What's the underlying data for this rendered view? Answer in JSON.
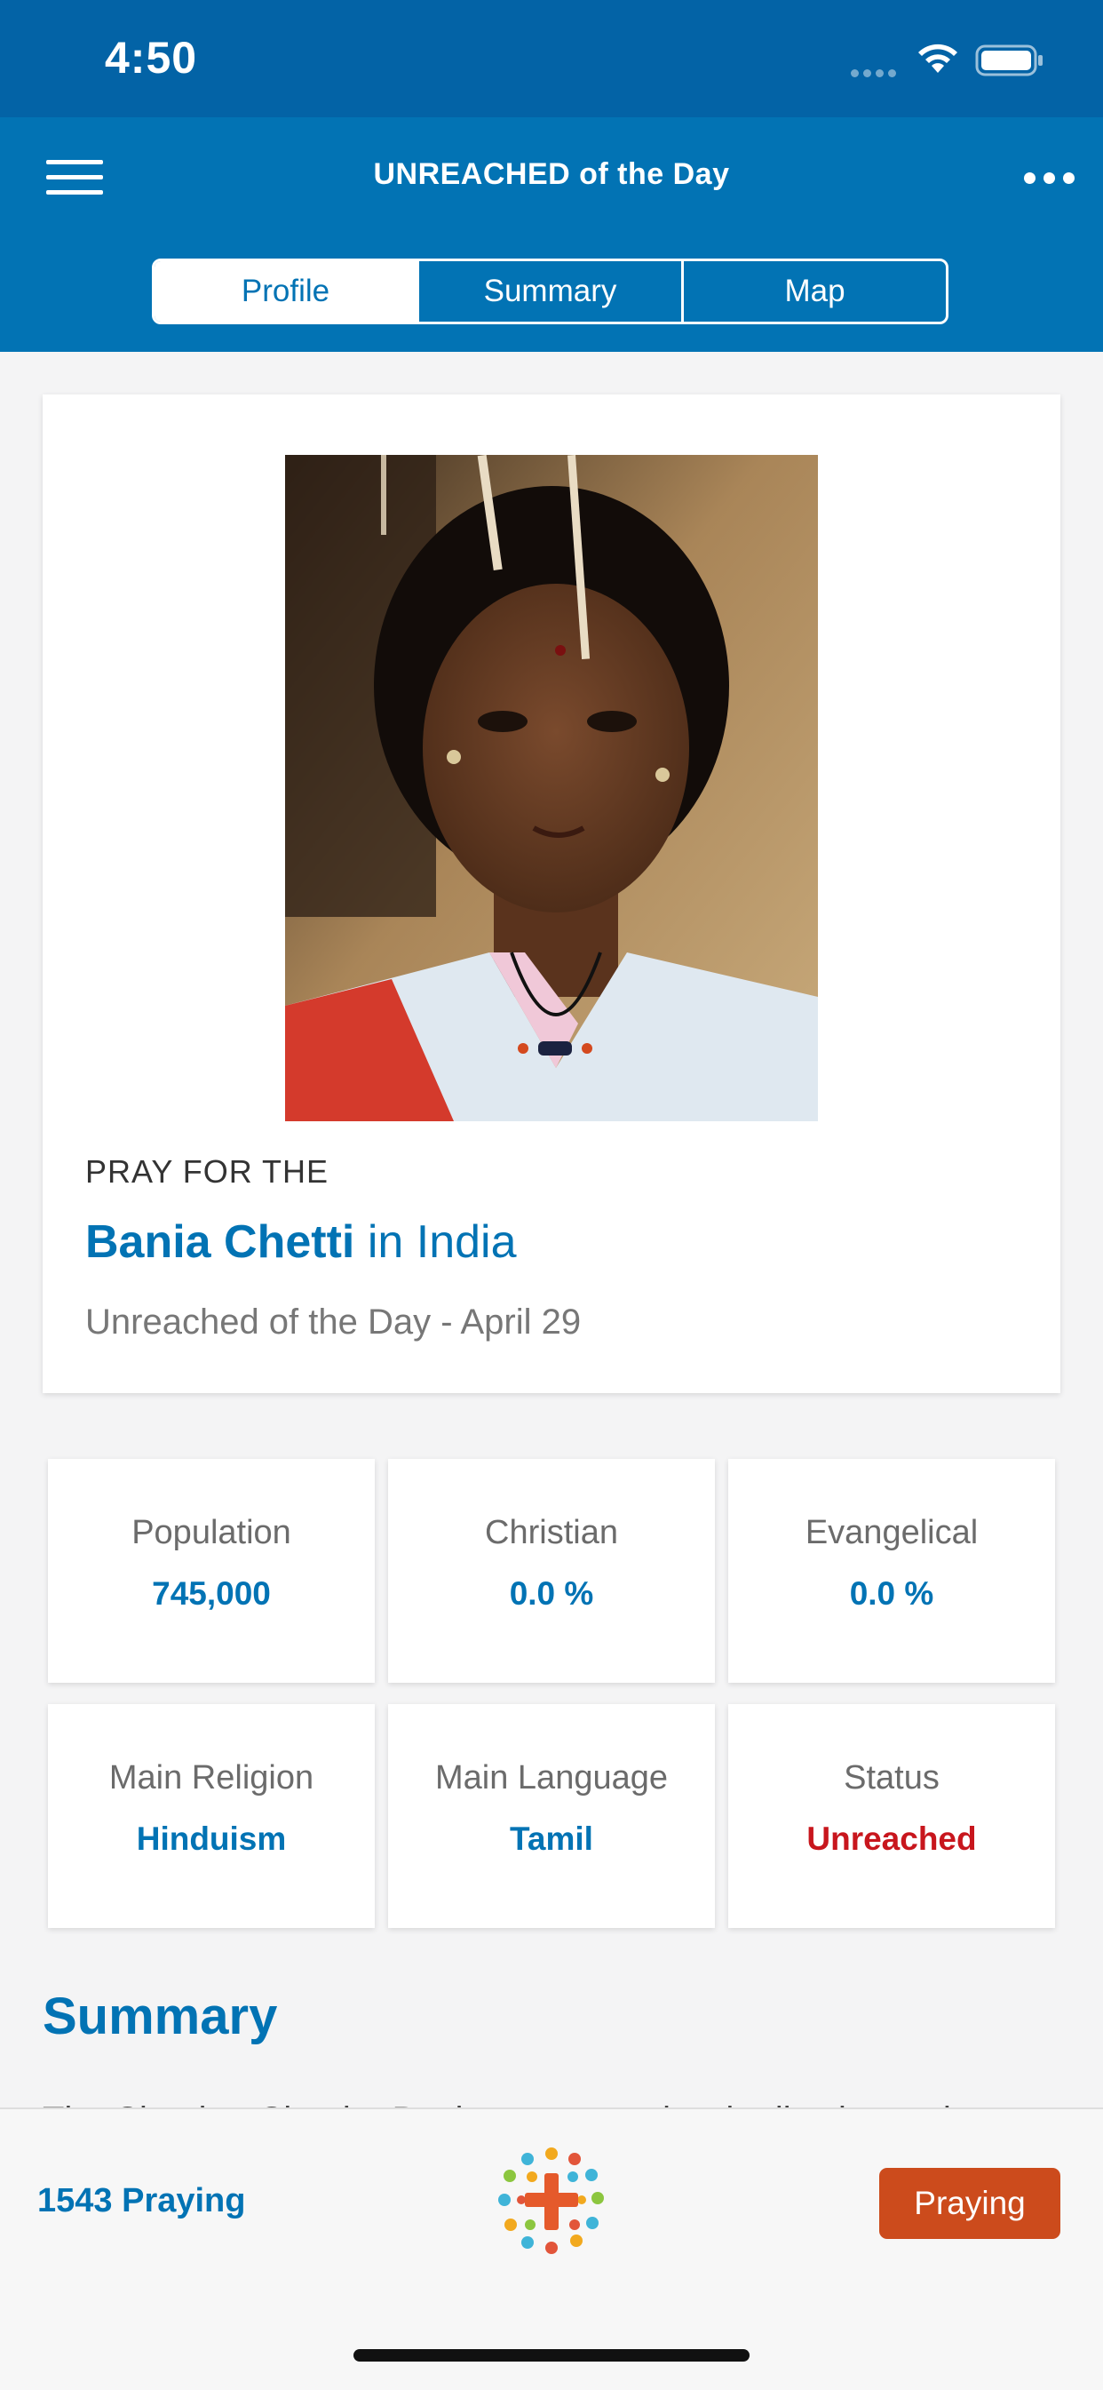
{
  "status_bar": {
    "time": "4:50"
  },
  "header": {
    "title": "UNREACHED of the Day",
    "tabs": [
      {
        "label": "Profile",
        "active": true
      },
      {
        "label": "Summary",
        "active": false
      },
      {
        "label": "Map",
        "active": false
      }
    ]
  },
  "profile": {
    "pray_label": "PRAY FOR THE",
    "people_name": "Bania Chetti",
    "in_country": "in India",
    "subtitle": "Unreached of the Day - April 29"
  },
  "stats": [
    {
      "label": "Population",
      "value": "745,000"
    },
    {
      "label": "Christian",
      "value": "0.0 %"
    },
    {
      "label": "Evangelical",
      "value": "0.0 %"
    },
    {
      "label": "Main Religion",
      "value": "Hinduism"
    },
    {
      "label": "Main Language",
      "value": "Tamil"
    },
    {
      "label": "Status",
      "value": "Unreached"
    }
  ],
  "summary": {
    "heading": "Summary",
    "text_start": "The Chetti or Chettiar Bania are a people who live in south"
  },
  "footer": {
    "praying_count": "1543 Praying",
    "praying_button": "Praying"
  },
  "colors": {
    "primary_blue": "#0273b4",
    "status_bar_blue": "#0363a6",
    "unreached_red": "#c8161d",
    "praying_orange": "#cc4b1c"
  }
}
